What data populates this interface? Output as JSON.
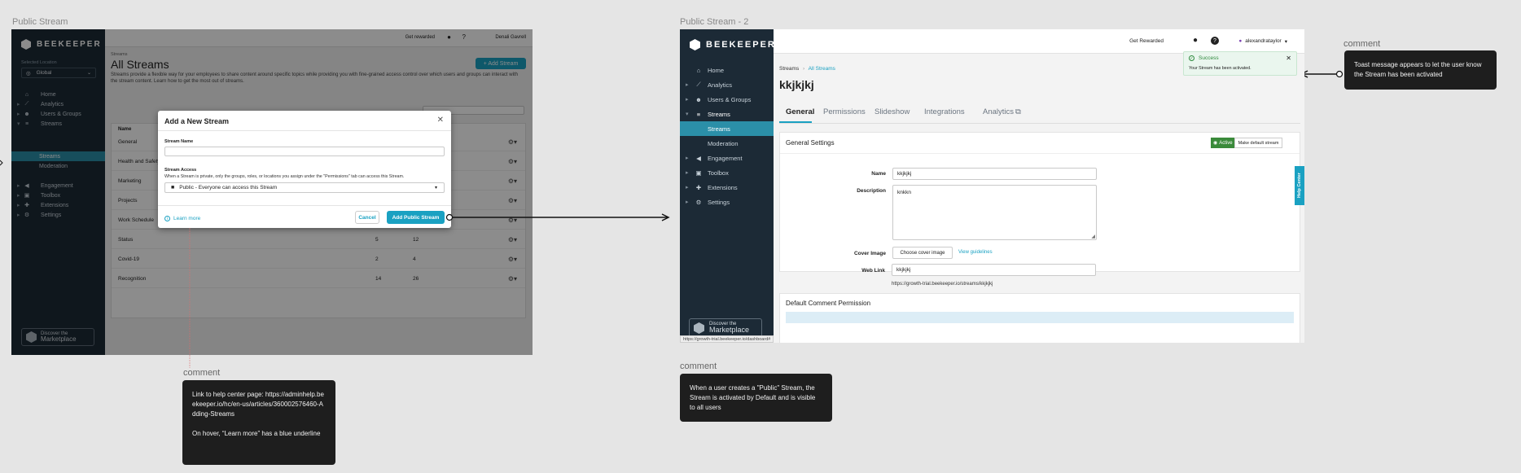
{
  "frame1": {
    "label": "Public Stream",
    "brand": "BEEKEEPER",
    "location_label": "Selected Location",
    "location_value": "Global",
    "nav": [
      "Home",
      "Analytics",
      "Users & Groups",
      "Streams",
      "Streams",
      "Moderation",
      "Engagement",
      "Toolbox",
      "Extensions",
      "Settings"
    ],
    "marketplace": {
      "line1": "Discover the",
      "line2": "Marketplace"
    },
    "header": {
      "get_rewarded": "Get rewarded",
      "user": "Denali Gavrell"
    },
    "breadcrumb": "Streams",
    "title": "All Streams",
    "add_button": "+ Add Stream",
    "description": "Streams provide a flexible way for your employees to share content around specific topics while providing you with fine-grained access control over which users and groups can interact with the stream content. Learn how to get the most out of streams.",
    "table_header": "Name",
    "rows": [
      {
        "name": "General",
        "a": "",
        "b": ""
      },
      {
        "name": "Health and Safety",
        "a": "",
        "b": ""
      },
      {
        "name": "Marketing",
        "a": "",
        "b": ""
      },
      {
        "name": "Projects",
        "a": "",
        "b": ""
      },
      {
        "name": "Work Schedule",
        "a": "",
        "b": ""
      },
      {
        "name": "Status",
        "a": "5",
        "b": "12"
      },
      {
        "name": "Covid-19",
        "a": "2",
        "b": "4"
      },
      {
        "name": "Recognition",
        "a": "14",
        "b": "26"
      }
    ]
  },
  "modal": {
    "title": "Add a New Stream",
    "stream_name_label": "Stream Name",
    "stream_access_label": "Stream Access",
    "access_help": "When a Stream is private, only the groups, roles, or locations you assign under the \"Permissions\" tab can access this Stream.",
    "access_value": "Public - Everyone can access this Stream",
    "learn_more": "Learn more",
    "cancel": "Cancel",
    "submit": "Add Public Stream"
  },
  "frame2": {
    "label": "Public Stream - 2",
    "brand": "BEEKEEPER",
    "nav": [
      "Home",
      "Analytics",
      "Users & Groups",
      "Streams",
      "Streams",
      "Moderation",
      "Engagement",
      "Toolbox",
      "Extensions",
      "Settings"
    ],
    "marketplace": {
      "line1": "Discover the",
      "line2": "Marketplace"
    },
    "status_url": "https://growth-trial.beekeeper.io/dashboard#",
    "header": {
      "get_rewarded": "Get Rewarded",
      "user": "alexandrataylor"
    },
    "breadcrumb": {
      "root": "Streams",
      "current": "All Streams"
    },
    "title": "kkjkjkj",
    "tabs": [
      "General",
      "Permissions",
      "Slideshow",
      "Integrations",
      "Analytics"
    ],
    "section_title": "General Settings",
    "active_badge": "Active",
    "default_stream_button": "Make default stream",
    "fields": {
      "name_label": "Name",
      "name_value": "kkjkjkj",
      "description_label": "Description",
      "description_value": "knkkn",
      "cover_label": "Cover Image",
      "cover_button": "Choose cover image",
      "guidelines": "View guidelines",
      "weblink_label": "Web Link",
      "weblink_value": "kkjkjkj",
      "weblink_url": "https://growth-trial.beekeeper.io/streams/kkjkjkj"
    },
    "second_section_title": "Default Comment Permission",
    "help_center": "Help Center",
    "toast": {
      "title": "Success",
      "message": "Your Stream has been activated."
    }
  },
  "comments": {
    "label": "comment",
    "learn_more_note": {
      "p1": "Link to help center page: https://adminhelp.beekeeper.io/hc/en-us/articles/360002576460-Adding-Streams",
      "p2": "On hover, “Learn more” has a blue underline"
    },
    "public_note": "When a user creates a \"Public\" Stream, the Stream is activated by Default and is visible to all users",
    "toast_note": "Toast message appears to let the user know the Stream has been activated"
  },
  "colors": {
    "sidebar": "#1c2a36",
    "accent": "#1aa1c2",
    "active_nav": "#2b8fa8",
    "success": "#3a8a3a"
  }
}
